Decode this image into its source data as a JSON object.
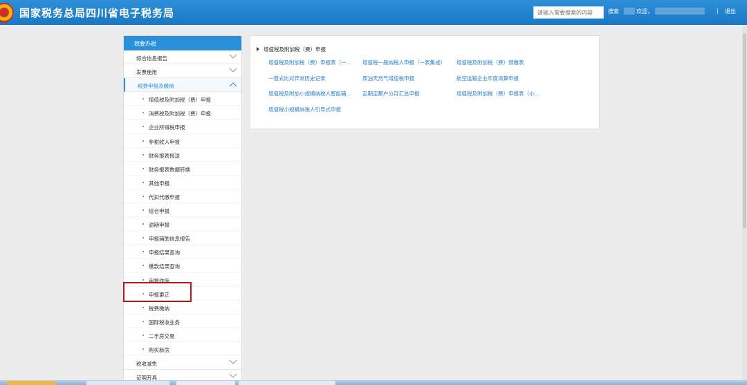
{
  "header": {
    "title": "国家税务总局四川省电子税务局",
    "search_placeholder": "请输入需要搜索的内容",
    "search_label": "搜索",
    "welcome": "欢迎，",
    "separator": "|",
    "logout": "退出"
  },
  "sidebar": {
    "title": "我要办税",
    "groups_top": [
      {
        "label": "综合信息报告"
      },
      {
        "label": "发票使用"
      }
    ],
    "active_group": {
      "label": "税费申报及缴纳"
    },
    "sub_items": [
      "增值税及附加税（费）申报",
      "消费税及附加税（费）申报",
      "企业所得税申报",
      "非税收入申报",
      "财务报表报送",
      "财务报表数据转换",
      "其他申报",
      "代扣代缴申报",
      "综合申报",
      "逾期申报",
      "申报辅助信息报告",
      "申报结果查询",
      "缴款结果查询",
      "申报作废",
      "申报更正",
      "税费缴纳",
      "国际税收业务",
      "二手房交易",
      "购买新房"
    ],
    "groups_bottom": [
      {
        "label": "税收减免"
      },
      {
        "label": "证明开具"
      }
    ]
  },
  "content": {
    "section_title": "增值税及附加税（费）申报",
    "links": [
      "增值税及附加税（费）申报表（一…",
      "增值税一般纳税人申报（一表集成）",
      "增值税及附加税（费）预缴表",
      "一窗式比对异常历史记录",
      "原油天然气增值税申报",
      "航空运输企业年度清算申报",
      "增值税及附加小规模纳税人智能辅…",
      "定期定额户分月汇总申报",
      "增值税及附加税（费）申报表（小…",
      "增值税小规模纳税人引导式申报"
    ]
  },
  "colors": {
    "header": "#1b78c4",
    "accent": "#2a91d8",
    "link": "#2a7fc8",
    "highlight": "#c0141b"
  },
  "icons": {
    "emblem": "tax-emblem-icon",
    "expand": "chevron-down-icon",
    "collapse": "chevron-up-icon"
  }
}
